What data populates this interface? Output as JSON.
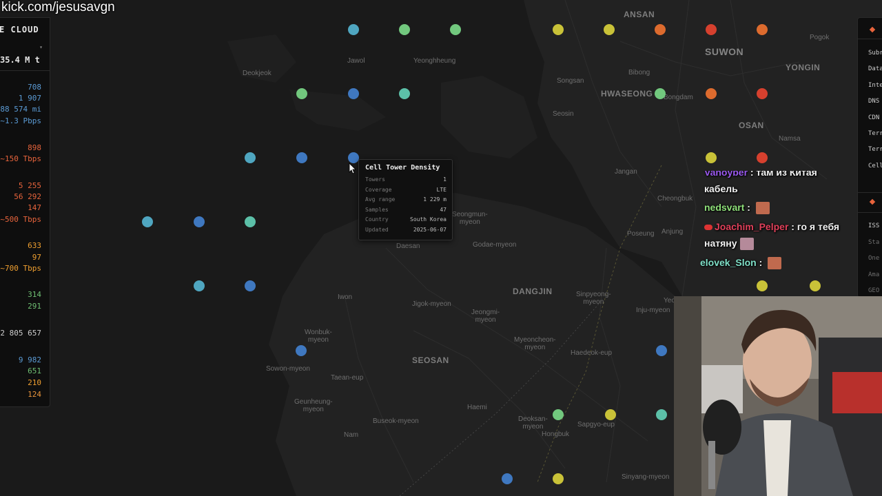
{
  "stream": {
    "url_text": "kick.com/jesusavgn"
  },
  "left_panel": {
    "title": "E CLOUD",
    "caret": "▾",
    "total": "35.4 M t",
    "stats": [
      {
        "value": "708",
        "color": "#5b9bd5"
      },
      {
        "value": "1 907",
        "color": "#5b9bd5"
      },
      {
        "value": "88 574 mi",
        "color": "#5b9bd5"
      },
      {
        "value": "~1.3 Pbps",
        "color": "#5b9bd5"
      },
      {
        "value": "898",
        "color": "#e8643c"
      },
      {
        "value": "~150 Tbps",
        "color": "#e8643c"
      },
      {
        "value": "5 255",
        "color": "#e8643c"
      },
      {
        "value": "56 292",
        "color": "#e8643c"
      },
      {
        "value": "147",
        "color": "#e8643c"
      },
      {
        "value": "~500 Tbps",
        "color": "#e8643c"
      },
      {
        "value": "633",
        "color": "#f0a030"
      },
      {
        "value": "97",
        "color": "#f0a030"
      },
      {
        "value": "~700 Tbps",
        "color": "#f0a030"
      },
      {
        "value": "314",
        "color": "#6fbf73"
      },
      {
        "value": "291",
        "color": "#6fbf73"
      },
      {
        "value": "2 805 657",
        "color": "#cfcfcf"
      },
      {
        "value": "9 982",
        "color": "#5b9bd5"
      },
      {
        "value": "651",
        "color": "#6fbf73"
      },
      {
        "value": "210",
        "color": "#f0a030"
      },
      {
        "value": "124",
        "color": "#e8943c"
      }
    ]
  },
  "tooltip": {
    "title": "Cell Tower Density",
    "rows": [
      {
        "key": "Towers",
        "value": "1"
      },
      {
        "key": "Coverage",
        "value": "LTE"
      },
      {
        "key": "Avg range",
        "value": "1 229 m"
      },
      {
        "key": "Samples",
        "value": "47"
      },
      {
        "key": "Country",
        "value": "South Korea"
      },
      {
        "key": "Updated",
        "value": "2025-06-07"
      }
    ]
  },
  "right_panel": {
    "items": [
      "Subr",
      "Data",
      "Inte",
      "DNS",
      "CDN",
      "Terr",
      "Terr",
      "Cell"
    ],
    "items2": [
      "ISS",
      "Sta",
      "One",
      "Ama",
      "GEO"
    ]
  },
  "chat": {
    "messages": [
      {
        "user": "Vanoyber",
        "sep": " : ",
        "text": "там из Китая",
        "user_color": "#9b59f0"
      },
      {
        "user": "",
        "sep": "",
        "text": "кабель",
        "user_color": "#ffffff"
      },
      {
        "user": "nedsvart",
        "sep": " : ",
        "text": "",
        "user_color": "#8fe07a"
      },
      {
        "user": "Joachim_Pelper",
        "sep": " : ",
        "text": "го я тебя",
        "user_color": "#e0405a"
      },
      {
        "user": "",
        "sep": "",
        "text": "натяну",
        "user_color": "#ffffff"
      },
      {
        "user": "elovek_Slon",
        "sep": " : ",
        "text": "",
        "user_color": "#7fe0c8"
      }
    ]
  },
  "map": {
    "labels": [
      {
        "text": "ANSAN",
        "cls": "big"
      },
      {
        "text": "SUWON",
        "cls": "huge"
      },
      {
        "text": "YONGIN",
        "cls": "big"
      },
      {
        "text": "HWASEONG",
        "cls": "big"
      },
      {
        "text": "OSAN",
        "cls": "big"
      },
      {
        "text": "DANGJIN",
        "cls": "big"
      },
      {
        "text": "SEOSAN",
        "cls": "big"
      },
      {
        "text": "Deokjeok",
        "cls": ""
      },
      {
        "text": "Jawol",
        "cls": ""
      },
      {
        "text": "Yeonghheung",
        "cls": ""
      },
      {
        "text": "Bibong",
        "cls": ""
      },
      {
        "text": "Songsan",
        "cls": ""
      },
      {
        "text": "Seosin",
        "cls": ""
      },
      {
        "text": "Jangan",
        "cls": ""
      },
      {
        "text": "Cheongbuk",
        "cls": ""
      },
      {
        "text": "Poseung",
        "cls": ""
      },
      {
        "text": "Anjung",
        "cls": ""
      },
      {
        "text": "Namsa",
        "cls": ""
      },
      {
        "text": "Pogok",
        "cls": ""
      },
      {
        "text": "Bongdam",
        "cls": ""
      },
      {
        "text": "Seongmun-\nmyeon",
        "cls": ""
      },
      {
        "text": "Daesan",
        "cls": ""
      },
      {
        "text": "Godae-myeon",
        "cls": ""
      },
      {
        "text": "Jigok-myeon",
        "cls": ""
      },
      {
        "text": "Iwon",
        "cls": ""
      },
      {
        "text": "Jeongmi-\nmyeon",
        "cls": ""
      },
      {
        "text": "Sinpyeong-\nmyeon",
        "cls": ""
      },
      {
        "text": "Inju-myeon",
        "cls": ""
      },
      {
        "text": "Wonbuk-\nmyeon",
        "cls": ""
      },
      {
        "text": "Sowon-myeon",
        "cls": ""
      },
      {
        "text": "Taean-eup",
        "cls": ""
      },
      {
        "text": "Myeoncheon-\nmyeon",
        "cls": ""
      },
      {
        "text": "Haedeok-eup",
        "cls": ""
      },
      {
        "text": "Geunheung-\nmyeon",
        "cls": ""
      },
      {
        "text": "Haemi",
        "cls": ""
      },
      {
        "text": "Buseok-myeon",
        "cls": ""
      },
      {
        "text": "Nam",
        "cls": ""
      },
      {
        "text": "Deoksan-\nmyeon",
        "cls": ""
      },
      {
        "text": "Sapgyo-eup",
        "cls": ""
      },
      {
        "text": "Hongbuk",
        "cls": ""
      },
      {
        "text": "Sinyang-myeon",
        "cls": ""
      },
      {
        "text": "Yeo",
        "cls": ""
      }
    ],
    "dot_colors": {
      "blue": "#3f78c0",
      "cyan": "#4fa6c0",
      "teal": "#5cc0a8",
      "green": "#72c87e",
      "yellow": "#c9c238",
      "orange": "#dd6b2e",
      "red": "#d6402e"
    },
    "dots": [
      {
        "c": "cyan"
      },
      {
        "c": "green"
      },
      {
        "c": "green"
      },
      {
        "c": "yellow"
      },
      {
        "c": "yellow"
      },
      {
        "c": "orange"
      },
      {
        "c": "red"
      },
      {
        "c": "orange"
      },
      {
        "c": "green"
      },
      {
        "c": "blue"
      },
      {
        "c": "teal"
      },
      {
        "c": "green"
      },
      {
        "c": "orange"
      },
      {
        "c": "red"
      },
      {
        "c": "cyan"
      },
      {
        "c": "blue"
      },
      {
        "c": "blue"
      },
      {
        "c": "yellow"
      },
      {
        "c": "red"
      },
      {
        "c": "cyan"
      },
      {
        "c": "blue"
      },
      {
        "c": "teal"
      },
      {
        "c": "cyan"
      },
      {
        "c": "blue"
      },
      {
        "c": "yellow"
      },
      {
        "c": "yellow"
      },
      {
        "c": "blue"
      },
      {
        "c": "blue"
      },
      {
        "c": "green"
      },
      {
        "c": "yellow"
      },
      {
        "c": "teal"
      },
      {
        "c": "blue"
      },
      {
        "c": "yellow"
      }
    ]
  }
}
